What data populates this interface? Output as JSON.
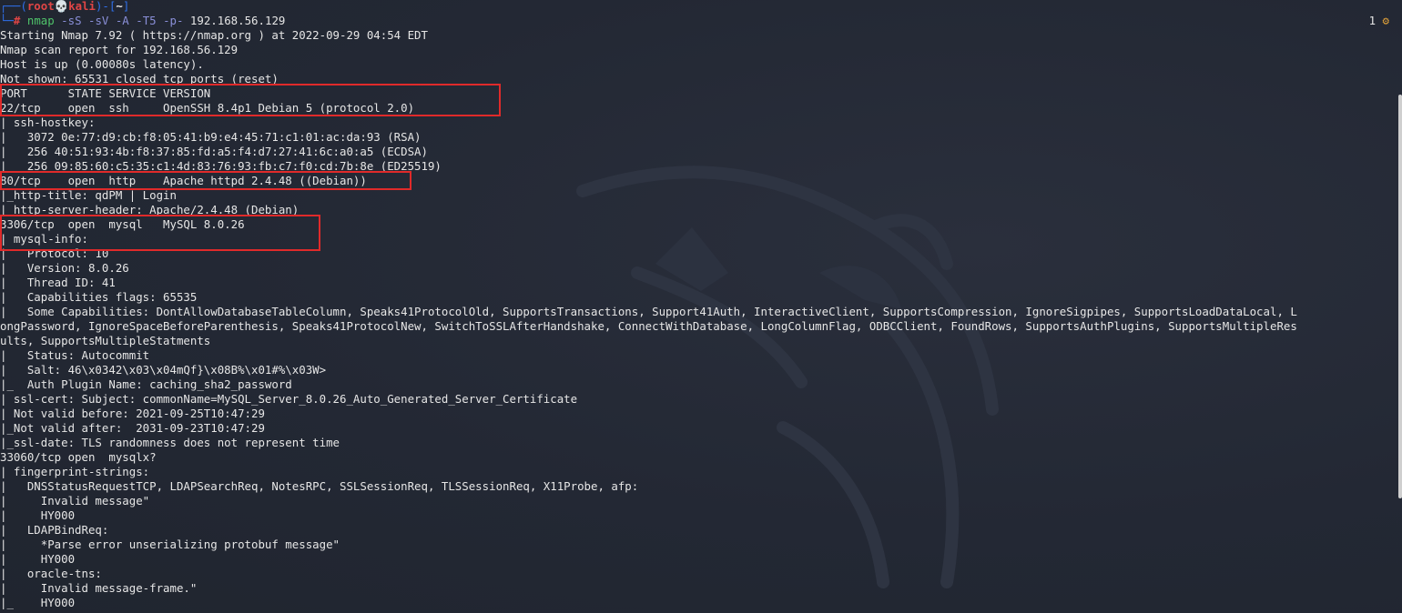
{
  "prompt": {
    "frame_top": "┌──(",
    "user": "root",
    "skull": "💀",
    "host": "kali",
    "mid": ")-[",
    "dir": "~",
    "end": "]",
    "frame_bottom": "└─",
    "hash": "#",
    "cmd": "nmap",
    "flags": "-sS -sV -A -T5 -p-",
    "target": "192.168.56.129"
  },
  "status_right": {
    "jobs": "1",
    "gear_icon": "gear-icon"
  },
  "colors": {
    "background": "#232834",
    "text": "#e6e6e6",
    "highlight_box": "#e02a2a",
    "prompt_red": "#e04545",
    "prompt_blue": "#2f6fea",
    "command_green": "#4fc36a"
  },
  "output": [
    "Starting Nmap 7.92 ( https://nmap.org ) at 2022-09-29 04:54 EDT",
    "Nmap scan report for 192.168.56.129",
    "Host is up (0.00080s latency).",
    "Not shown: 65531 closed tcp ports (reset)",
    "PORT      STATE SERVICE VERSION",
    "22/tcp    open  ssh     OpenSSH 8.4p1 Debian 5 (protocol 2.0)",
    "| ssh-hostkey: ",
    "|   3072 0e:77:d9:cb:f8:05:41:b9:e4:45:71:c1:01:ac:da:93 (RSA)",
    "|   256 40:51:93:4b:f8:37:85:fd:a5:f4:d7:27:41:6c:a0:a5 (ECDSA)",
    "|_  256 09:85:60:c5:35:c1:4d:83:76:93:fb:c7:f0:cd:7b:8e (ED25519)",
    "80/tcp    open  http    Apache httpd 2.4.48 ((Debian))",
    "|_http-title: qdPM | Login",
    "|_http-server-header: Apache/2.4.48 (Debian)",
    "3306/tcp  open  mysql   MySQL 8.0.26",
    "| mysql-info: ",
    "|   Protocol: 10",
    "|   Version: 8.0.26",
    "|   Thread ID: 41",
    "|   Capabilities flags: 65535",
    "|   Some Capabilities: DontAllowDatabaseTableColumn, Speaks41ProtocolOld, SupportsTransactions, Support41Auth, InteractiveClient, SupportsCompression, IgnoreSigpipes, SupportsLoadDataLocal, L",
    "ongPassword, IgnoreSpaceBeforeParenthesis, Speaks41ProtocolNew, SwitchToSSLAfterHandshake, ConnectWithDatabase, LongColumnFlag, ODBCClient, FoundRows, SupportsAuthPlugins, SupportsMultipleRes",
    "ults, SupportsMultipleStatments",
    "|   Status: Autocommit",
    "|   Salt: 46\\x0342\\x03\\x04mQf}\\x08B%\\x01#%\\x03W>",
    "|_  Auth Plugin Name: caching_sha2_password",
    "| ssl-cert: Subject: commonName=MySQL_Server_8.0.26_Auto_Generated_Server_Certificate",
    "| Not valid before: 2021-09-25T10:47:29",
    "|_Not valid after:  2031-09-23T10:47:29",
    "|_ssl-date: TLS randomness does not represent time",
    "33060/tcp open  mysqlx?",
    "| fingerprint-strings: ",
    "|   DNSStatusRequestTCP, LDAPSearchReq, NotesRPC, SSLSessionReq, TLSSessionReq, X11Probe, afp: ",
    "|     Invalid message\"",
    "|     HY000",
    "|   LDAPBindReq: ",
    "|     *Parse error unserializing protobuf message\"",
    "|     HY000",
    "|   oracle-tns: ",
    "|     Invalid message-frame.\"",
    "|_    HY000"
  ]
}
